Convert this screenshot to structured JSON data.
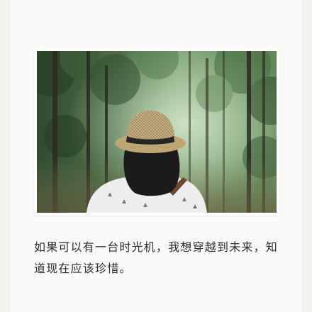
{
  "post": {
    "caption": "如果可以有一台时光机，我想穿越到未来，知道现在应该珍惜。"
  },
  "photo": {
    "icon": "photo-girl-straw-hat-forest",
    "colors": {
      "forest_dark": "#2f4a2c",
      "forest_light": "#9fc29a",
      "hat": "#c9b48a",
      "hat_band": "#2a2a2a",
      "hair": "#1c1a1a",
      "shirt": "#efefef"
    }
  }
}
